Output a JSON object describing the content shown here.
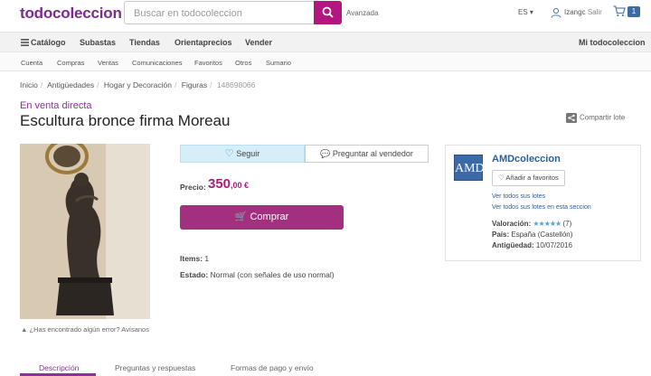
{
  "header": {
    "logo": "todocoleccion",
    "search_placeholder": "Buscar en todocoleccion",
    "advanced": "Avanzada",
    "language": "ES",
    "user": "Izangc",
    "logout": "Salir",
    "cart_count": "1"
  },
  "main_nav": {
    "catalog": "Catálogo",
    "auctions": "Subastas",
    "shops": "Tiendas",
    "orientaprecios": "Orientaprecios",
    "sell": "Vender",
    "my_account": "Mi todocoleccion"
  },
  "sub_nav": [
    "Cuenta",
    "Compras",
    "Ventas",
    "Comunicaciones",
    "Favoritos",
    "Otros",
    "Sumario"
  ],
  "breadcrumb": [
    "Inicio",
    "Antigüedades",
    "Hogar y Decoración",
    "Figuras",
    "148698066"
  ],
  "listing": {
    "sale_type": "En venta directa",
    "title": "Escultura bronce firma Moreau",
    "share": "Compartir lote",
    "error_note": "¿Has encontrado algún error? Avísanos"
  },
  "actions": {
    "follow": "Seguir",
    "ask_seller": "Preguntar al vendedor",
    "price_label": "Precio:",
    "price_int": "350",
    "price_dec": ",00 €",
    "buy": "Comprar",
    "items_label": "Items:",
    "items_value": "1",
    "estado_label": "Estado:",
    "estado_value": "Normal (con señales de uso normal)"
  },
  "seller": {
    "logo_text": "AMD",
    "name": "AMDcoleccion",
    "add_favorites": "Añadir a favoritos",
    "all_lots": "Ver todos sus lotes",
    "section_lots": "Ver todos sus lotes en esta seccion",
    "rating_label": "Valoración:",
    "rating_stars": "★★★★★",
    "rating_count": "(7)",
    "country_label": "País:",
    "country_value": "España (Castellón)",
    "age_label": "Antigüedad:",
    "age_value": "10/07/2016"
  },
  "tabs": [
    "Descripción",
    "Preguntas y respuestas",
    "Formas de pago y envío"
  ],
  "colors": {
    "brand": "#7b2b8d",
    "buy_button": "#a3307f",
    "price": "#b1177e",
    "link": "#2a5e9b",
    "follow_bg": "#d5eef8"
  }
}
